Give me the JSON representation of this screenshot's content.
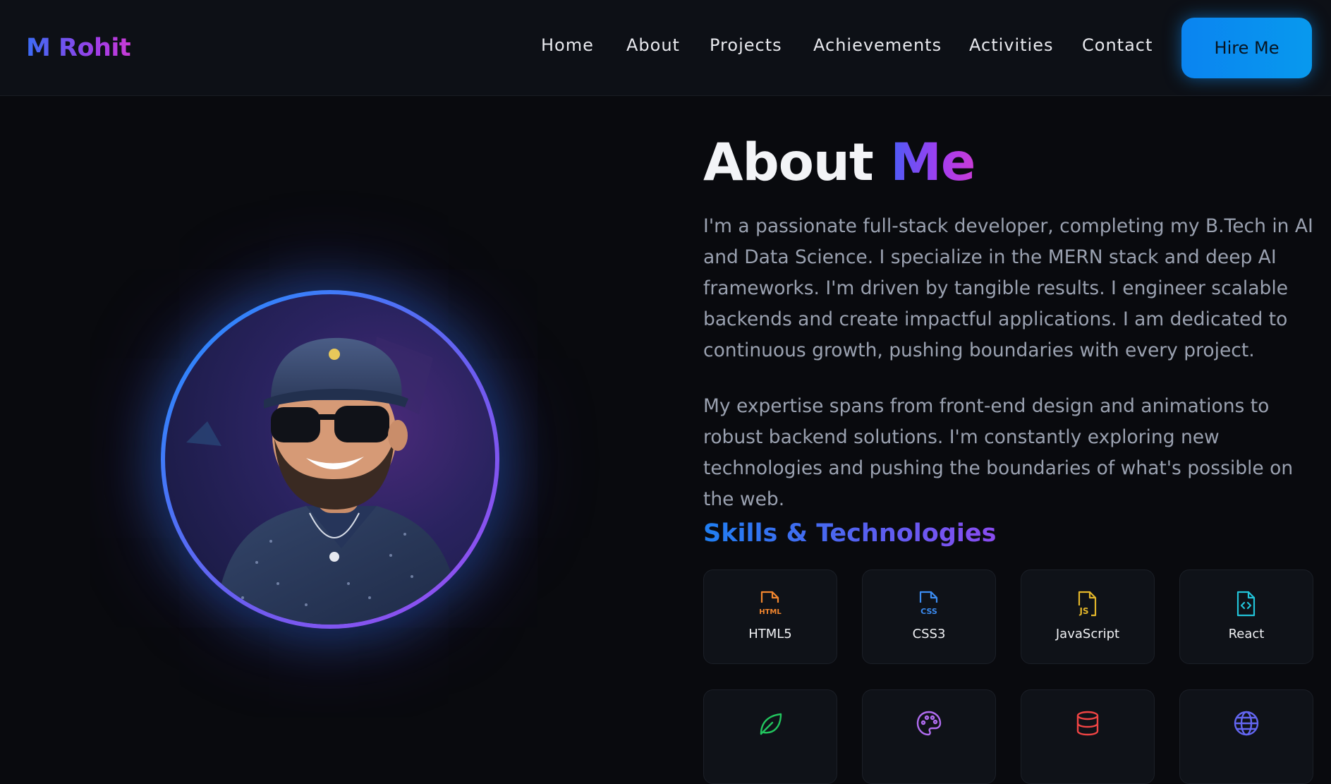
{
  "header": {
    "logo": "M Rohit",
    "nav": [
      "Home",
      "About",
      "Projects",
      "Achievements",
      "Activities",
      "Contact"
    ],
    "cta": "Hire Me"
  },
  "about": {
    "title_part1": "About ",
    "title_part2": "Me",
    "paragraph1": "I'm a passionate full-stack developer, completing my B.Tech in AI and Data Science. I specialize in the MERN stack and deep AI frameworks. I'm driven by tangible results. I engineer scalable backends and create impactful applications. I am dedicated to continuous growth, pushing boundaries with every project.",
    "paragraph2": "My expertise spans from front-end design and animations to robust backend solutions. I'm constantly exploring new technologies and pushing the boundaries of what's possible on the web.",
    "skills_title": "Skills & Technologies"
  },
  "skills": [
    {
      "label": "HTML5",
      "icon": "html-file-icon",
      "color": "#f2862e"
    },
    {
      "label": "CSS3",
      "icon": "css-file-icon",
      "color": "#3b8bf0"
    },
    {
      "label": "JavaScript",
      "icon": "js-file-icon",
      "color": "#e3b62a"
    },
    {
      "label": "React",
      "icon": "code-file-icon",
      "color": "#22c3d8"
    },
    {
      "label": "",
      "icon": "leaf-icon",
      "color": "#22c55e"
    },
    {
      "label": "",
      "icon": "palette-icon",
      "color": "#b06cf0"
    },
    {
      "label": "",
      "icon": "database-icon",
      "color": "#ef4444"
    },
    {
      "label": "",
      "icon": "globe-icon",
      "color": "#6366f1"
    }
  ],
  "colors": {
    "background": "#090a0e",
    "accent_blue": "#0a84f0",
    "accent_purple": "#a43df0"
  }
}
